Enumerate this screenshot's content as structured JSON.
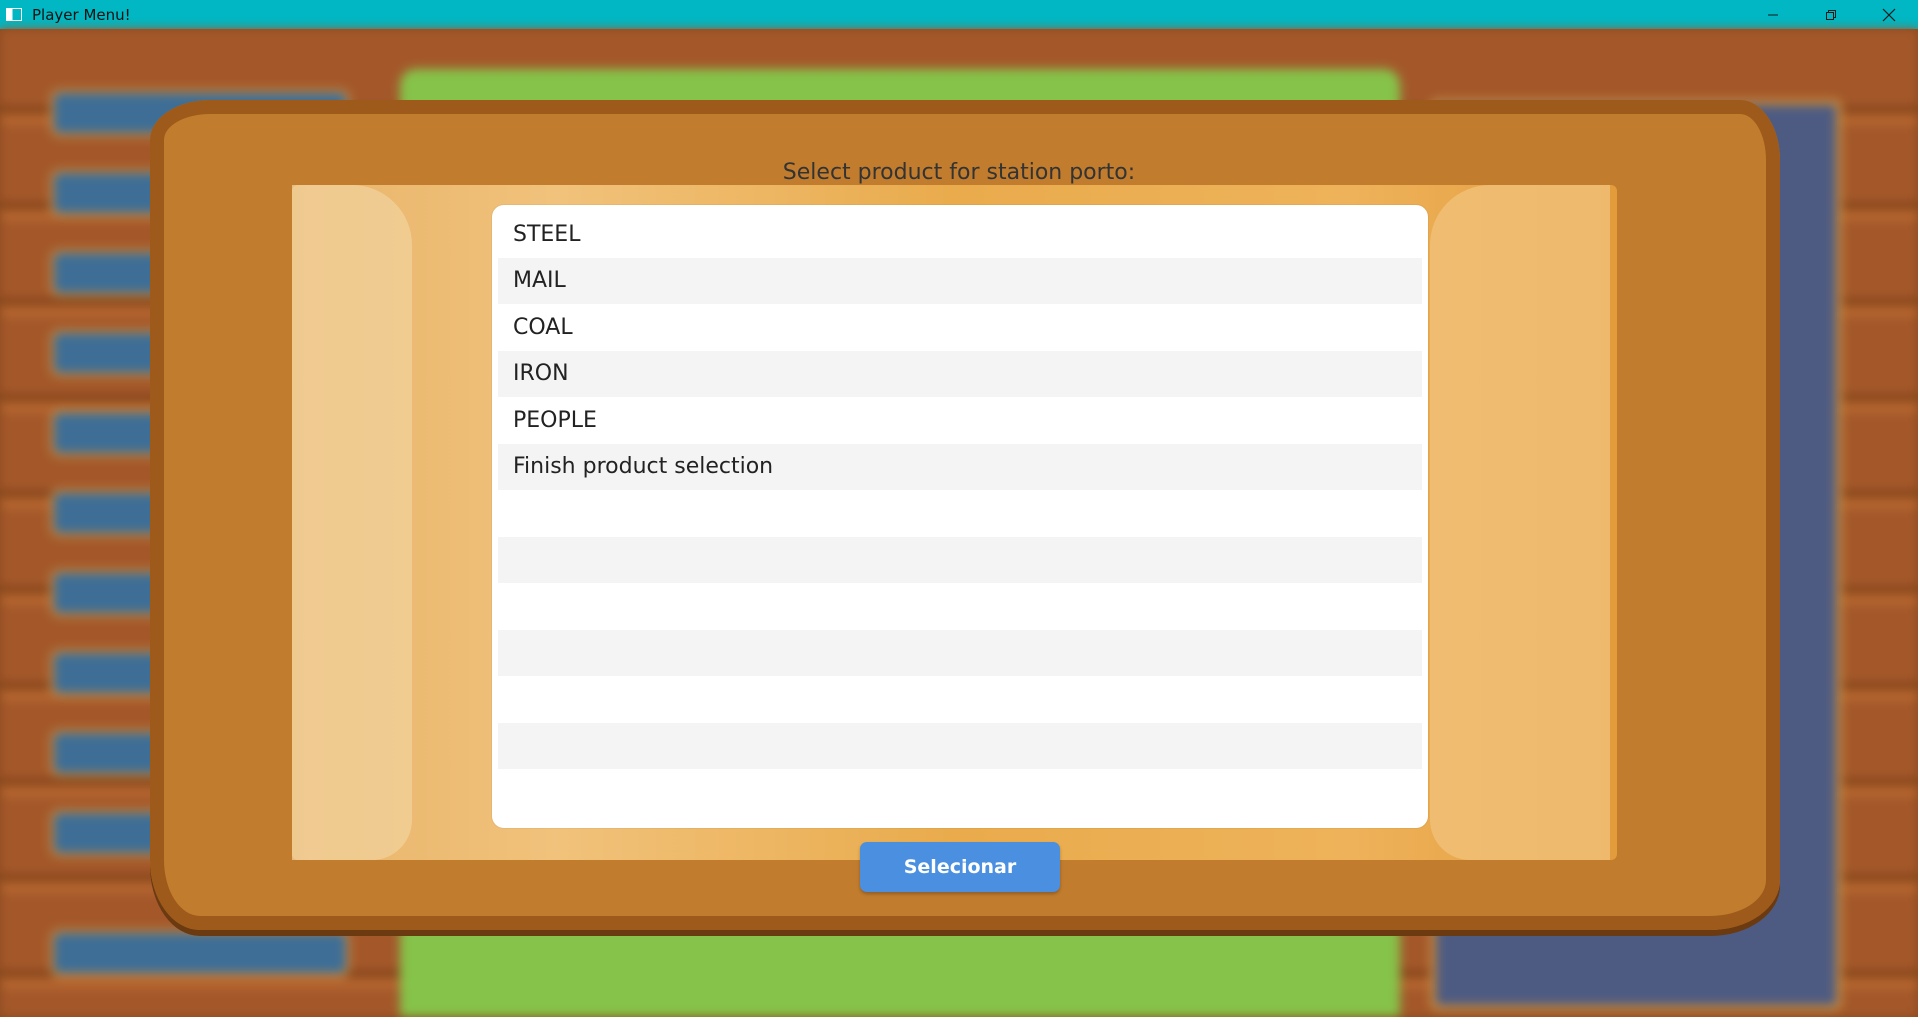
{
  "window": {
    "title": "Player Menu!",
    "controls": {
      "minimize": "minimize-icon",
      "restore": "restore-icon",
      "close": "close-icon"
    }
  },
  "dialog": {
    "prompt": "Select product for station porto:",
    "items": [
      "STEEL",
      "MAIL",
      "COAL",
      "IRON",
      "PEOPLE",
      "Finish product selection",
      "",
      "",
      "",
      "",
      "",
      "",
      ""
    ],
    "button_label": "Selecionar"
  },
  "colors": {
    "titlebar": "#00b7c3",
    "button": "#4a8fe0",
    "frame": "#c17c2e",
    "parchment": "#e9ab4c"
  }
}
